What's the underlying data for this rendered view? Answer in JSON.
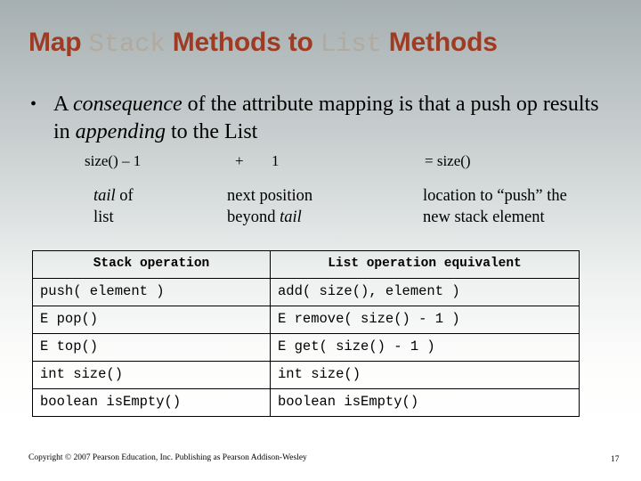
{
  "slide": {
    "background_top_color": "#a6afb1",
    "background_bottom_color": "#ffffff",
    "title_accent_color": "#9e3b22",
    "title_mono_color": "#b3aa9f",
    "title": {
      "part1": "Map ",
      "part2": "Stack",
      "part3": " Methods to ",
      "part4": "List",
      "part5": " Methods"
    }
  },
  "bullet": {
    "marker": "•",
    "line1_a": "A ",
    "line1_em": "consequence",
    "line1_b": " of the attribute mapping is that a",
    "line2_a": "push op results in ",
    "line2_em": "appending",
    "line2_b": " to the List"
  },
  "equation": {
    "left": "size() – 1",
    "plus": "+",
    "one": "1",
    "result": "=  size()"
  },
  "descriptions": {
    "col1_em": "tail",
    "col1_rest": " of",
    "col1_line2": "list",
    "col2_line1": "next position",
    "col2_line2_a": "beyond ",
    "col2_line2_em": "tail",
    "col3_line1": "location to “push” the",
    "col3_line2": "new stack element"
  },
  "table": {
    "headers": [
      "Stack operation",
      "List operation equivalent"
    ],
    "rows": [
      {
        "stack": "push( element )",
        "list": "add( size(), element )"
      },
      {
        "stack": "E pop()",
        "list": "E remove( size() - 1 )"
      },
      {
        "stack": "E top()",
        "list": "E get( size() - 1 )"
      },
      {
        "stack": "int size()",
        "list": "int size()"
      },
      {
        "stack": "boolean isEmpty()",
        "list": "boolean isEmpty()"
      }
    ]
  },
  "footer": {
    "copyright": "Copyright © 2007 Pearson Education, Inc. Publishing as Pearson Addison-Wesley",
    "page_number": "17"
  }
}
